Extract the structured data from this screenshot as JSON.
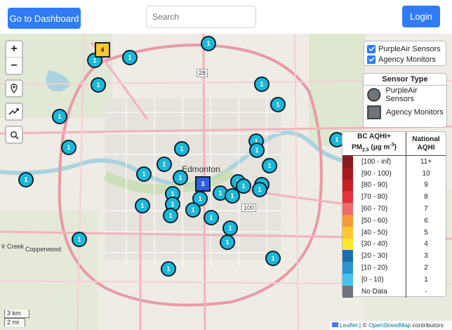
{
  "header": {
    "dashboard_label": "Go to Dashboard",
    "search_placeholder": "Search",
    "login_label": "Login"
  },
  "map_controls": {
    "zoom_in": "+",
    "zoom_out": "−",
    "icons": [
      "location-pin-icon",
      "trend-line-icon",
      "search-icon"
    ]
  },
  "map_labels": {
    "city": "Edmonton",
    "route_28": "28",
    "route_100": "100",
    "left_area": "Ir Creek",
    "left_area2": "Copperwood"
  },
  "layers": {
    "purpleair": "PurpleAir Sensors",
    "agency": "Agency Monitors"
  },
  "sensor_type": {
    "title": "Sensor Type",
    "purpleair": "PurpleAir Sensors",
    "agency": "Agency Monitors"
  },
  "legend": {
    "col1_line1": "BC AQHI+",
    "col1_line2": "PM",
    "col1_sub": "2.5",
    "col1_units": " (µg m",
    "col1_exp": "-3",
    "col1_close": ")",
    "col2_line1": "National",
    "col2_line2": "AQHI",
    "rows": [
      {
        "range": "[100 - inf)",
        "aqhi": "11+",
        "color": "#8b1a1a"
      },
      {
        "range": "[90 - 100)",
        "aqhi": "10",
        "color": "#a8191e"
      },
      {
        "range": "[80 - 90)",
        "aqhi": "9",
        "color": "#c81e26"
      },
      {
        "range": "[70 - 80)",
        "aqhi": "8",
        "color": "#e8303a"
      },
      {
        "range": "[60 - 70)",
        "aqhi": "7",
        "color": "#ef6a6a"
      },
      {
        "range": "[50 - 60)",
        "aqhi": "6",
        "color": "#f79b3a"
      },
      {
        "range": "[40 - 50)",
        "aqhi": "5",
        "color": "#fdc830"
      },
      {
        "range": "[30 - 40)",
        "aqhi": "4",
        "color": "#fbe92b"
      },
      {
        "range": "[20 - 30)",
        "aqhi": "3",
        "color": "#1b6fa8"
      },
      {
        "range": "[10 - 20)",
        "aqhi": "2",
        "color": "#2996d0"
      },
      {
        "range": "[0 - 10)",
        "aqhi": "1",
        "color": "#45c3ec"
      },
      {
        "range": "No Data",
        "aqhi": "-",
        "color": "#6e747a"
      }
    ]
  },
  "scale": {
    "km": "3 km",
    "mi": "2 mi"
  },
  "attribution": {
    "leaflet": "Leaflet",
    "sep": " | © ",
    "osm": "OpenStreetMap",
    "tail": " contributors"
  },
  "markers": {
    "sensor_count": "1",
    "agency_orange_count": "4",
    "agency_blue_count": "3",
    "sensors": [
      {
        "id": "m1"
      },
      {
        "id": "m2"
      },
      {
        "id": "m3"
      },
      {
        "id": "m4"
      },
      {
        "id": "m5"
      },
      {
        "id": "m6"
      },
      {
        "id": "m7"
      },
      {
        "id": "m8"
      },
      {
        "id": "m9"
      },
      {
        "id": "m10"
      },
      {
        "id": "m11"
      },
      {
        "id": "m12"
      },
      {
        "id": "m13"
      },
      {
        "id": "m14"
      },
      {
        "id": "m15"
      },
      {
        "id": "m16"
      },
      {
        "id": "m17"
      },
      {
        "id": "m18"
      },
      {
        "id": "m19"
      },
      {
        "id": "m20"
      },
      {
        "id": "m21"
      },
      {
        "id": "m22"
      },
      {
        "id": "m23"
      },
      {
        "id": "m24"
      },
      {
        "id": "m25"
      },
      {
        "id": "m26"
      },
      {
        "id": "m27"
      },
      {
        "id": "m28"
      },
      {
        "id": "m29"
      },
      {
        "id": "m30"
      },
      {
        "id": "m31"
      },
      {
        "id": "m32"
      },
      {
        "id": "m33"
      },
      {
        "id": "m34"
      },
      {
        "id": "m35"
      },
      {
        "id": "m36"
      },
      {
        "id": "m37"
      }
    ]
  }
}
